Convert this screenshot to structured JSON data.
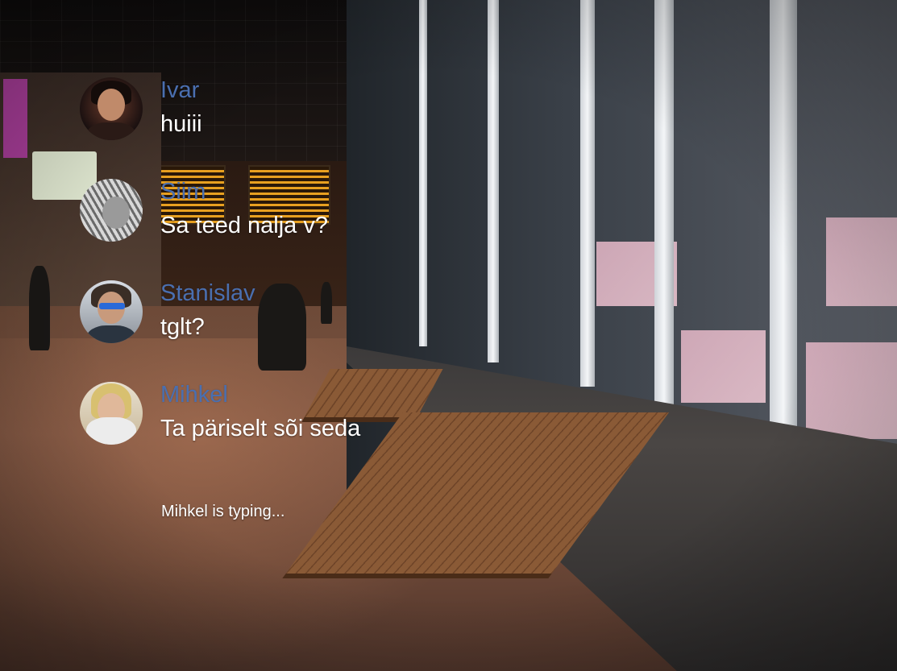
{
  "chat": {
    "messages": [
      {
        "author": "Ivar",
        "text": "huiii",
        "avatar_icon": "avatar-ivar"
      },
      {
        "author": "Siim",
        "text": "Sa teed nalja v?",
        "avatar_icon": "avatar-siim"
      },
      {
        "author": "Stanislav",
        "text": "tglt?",
        "avatar_icon": "avatar-stanislav"
      },
      {
        "author": "Mihkel",
        "text": "Ta päriselt sõi seda",
        "avatar_icon": "avatar-mihkel"
      }
    ],
    "typing_indicator": "Mihkel is typing...",
    "colors": {
      "author_name": "#4a6fb0",
      "message_text": "#ffffff"
    }
  }
}
